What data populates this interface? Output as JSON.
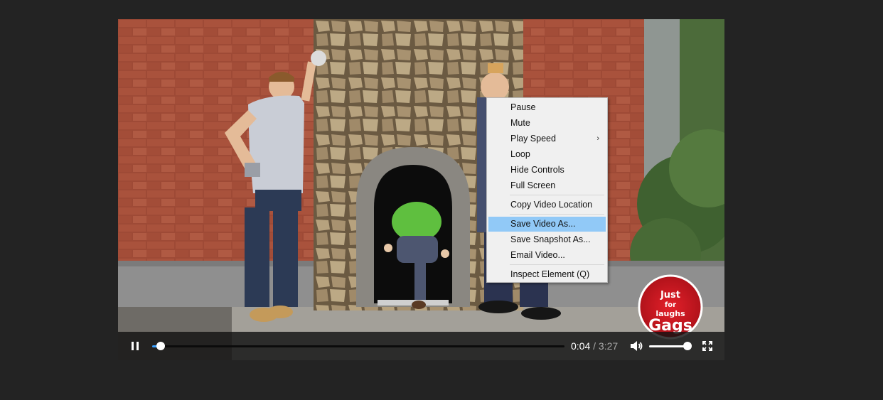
{
  "video": {
    "scene": "hidden-camera prank: brick wall with stone archway doorway, man in green shirt crawling through, two men watching",
    "logo_text": "Just for laughs Gags"
  },
  "controls": {
    "play_pause_icon": "pause-icon",
    "progress_fraction": 0.02,
    "current_time": "0:04",
    "separator": " / ",
    "duration": "3:27",
    "volume_icon": "volume-icon",
    "volume_fraction": 0.96,
    "fullscreen_icon": "fullscreen-icon",
    "accent_color": "#3aa0ff"
  },
  "context_menu": {
    "items": [
      {
        "label": "Pause"
      },
      {
        "label": "Mute"
      },
      {
        "label": "Play Speed",
        "submenu": true
      },
      {
        "label": "Loop"
      },
      {
        "label": "Hide Controls"
      },
      {
        "label": "Full Screen"
      },
      {
        "label": "Copy Video Location"
      },
      {
        "label": "Save Video As...",
        "highlighted": true
      },
      {
        "label": "Save Snapshot As..."
      },
      {
        "label": "Email Video..."
      },
      {
        "label": "Inspect Element (Q)"
      }
    ],
    "highlight_color": "#91c9f7"
  }
}
